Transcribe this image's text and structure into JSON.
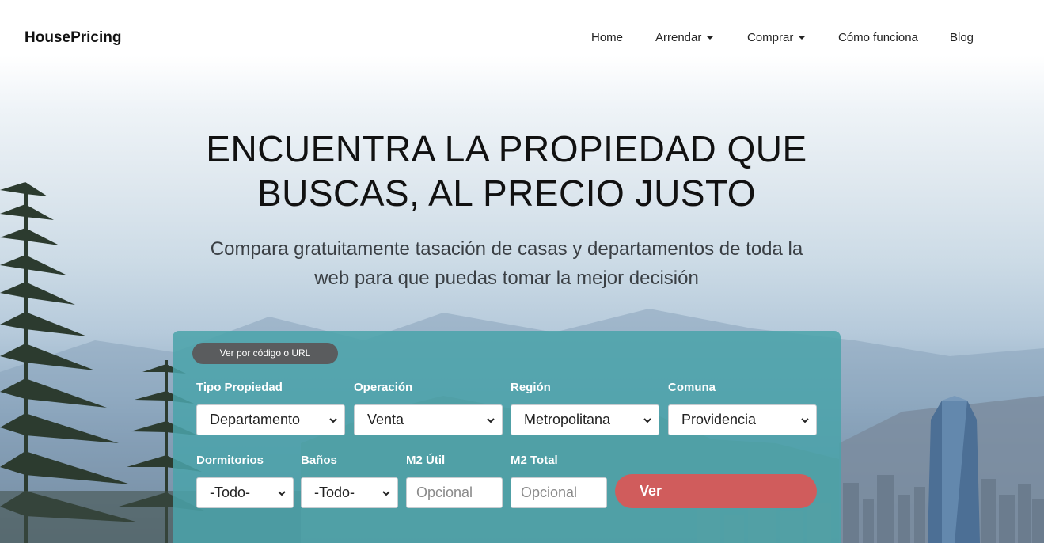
{
  "brand": "HousePricing",
  "nav": {
    "home": "Home",
    "arrendar": "Arrendar",
    "comprar": "Comprar",
    "como_funciona": "Cómo funciona",
    "blog": "Blog"
  },
  "hero": {
    "title_line1": "ENCUENTRA LA PROPIEDAD QUE",
    "title_line2": "BUSCAS, AL PRECIO JUSTO",
    "subtitle_line1": "Compara gratuitamente tasación de casas y departamentos de toda la",
    "subtitle_line2": "web para que puedas tomar la mejor decisión"
  },
  "search": {
    "code_button": "Ver por código o URL",
    "tipo_label": "Tipo Propiedad",
    "tipo_value": "Departamento",
    "operacion_label": "Operación",
    "operacion_value": "Venta",
    "region_label": "Región",
    "region_value": "Metropolitana",
    "comuna_label": "Comuna",
    "comuna_value": "Providencia",
    "dormitorios_label": "Dormitorios",
    "dormitorios_value": "-Todo-",
    "banos_label": "Baños",
    "banos_value": "-Todo-",
    "m2_util_label": "M2 Útil",
    "m2_util_placeholder": "Opcional",
    "m2_total_label": "M2 Total",
    "m2_total_placeholder": "Opcional",
    "submit": "Ver"
  },
  "colors": {
    "panel": "#4aa3aa",
    "code_button": "#5a5c5e",
    "submit_button": "#d05c5c"
  }
}
